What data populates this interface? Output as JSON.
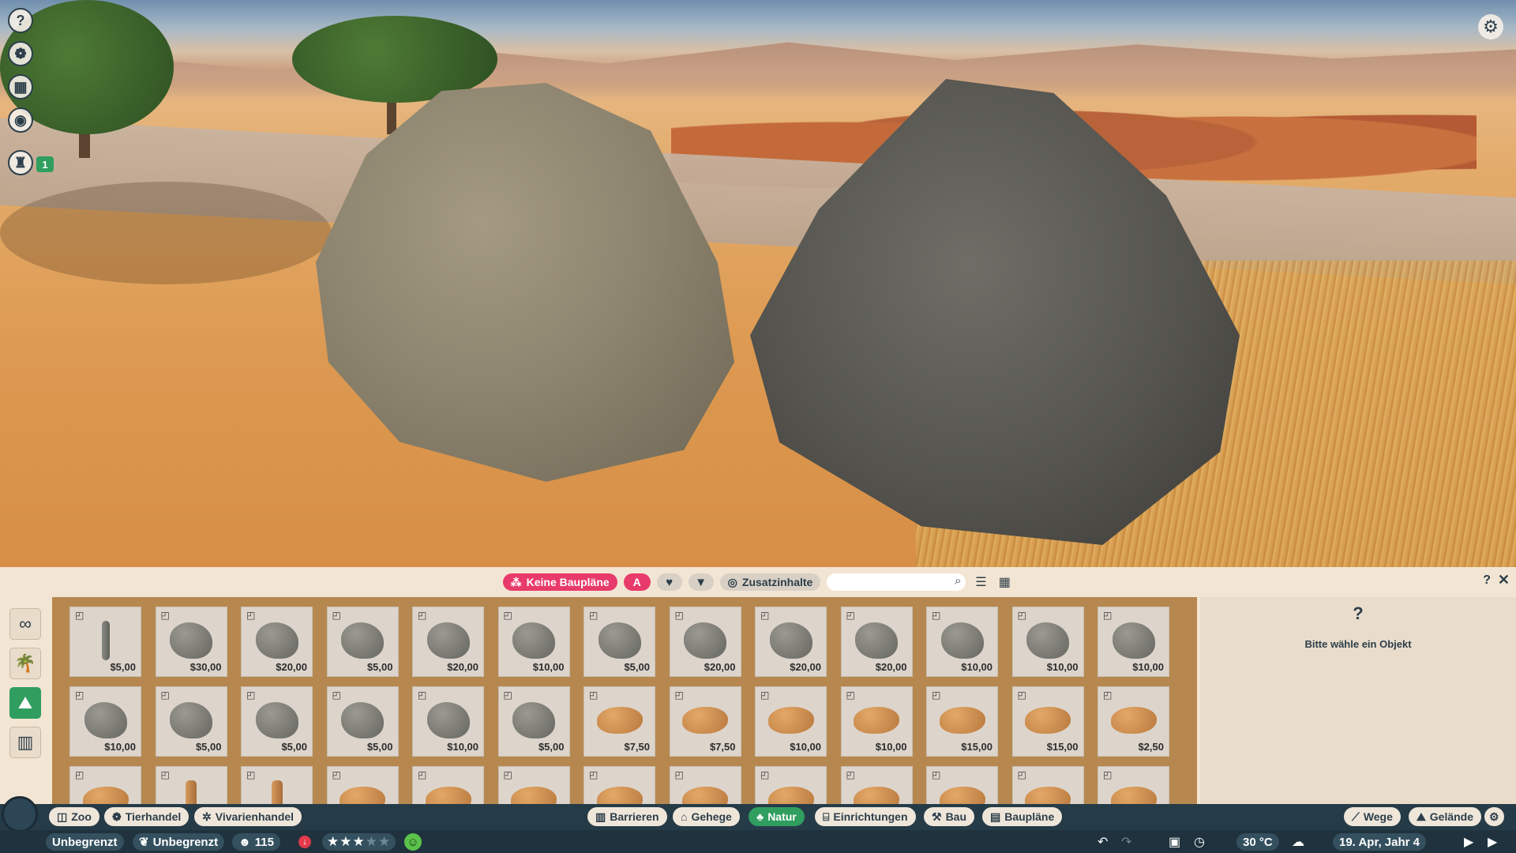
{
  "side_buttons": [
    {
      "name": "help",
      "icon": "question-icon",
      "glyph": "?"
    },
    {
      "name": "animals",
      "icon": "paw-icon",
      "glyph": "❁"
    },
    {
      "name": "schedule",
      "icon": "calendar-icon",
      "glyph": "▦"
    },
    {
      "name": "view",
      "icon": "eye-icon",
      "glyph": "◉"
    },
    {
      "name": "staff",
      "icon": "person-icon",
      "glyph": "♜"
    }
  ],
  "staff_badge": "1",
  "settings_icon": "gear-icon",
  "toolbar": {
    "blueprints_label": "Keine Baupläne",
    "alpha_label": "A",
    "favorite_icon": "heart-icon",
    "filter_icon": "filter-icon",
    "content_label": "Zusatzinhalte",
    "search_placeholder": "",
    "help": "?",
    "close": "✕"
  },
  "categories": [
    {
      "name": "infinity",
      "glyph": "∞",
      "active": false
    },
    {
      "name": "plants",
      "glyph": "🌴",
      "active": false
    },
    {
      "name": "rocks",
      "glyph": "⛰",
      "active": true
    },
    {
      "name": "fences",
      "glyph": "▥",
      "active": false
    }
  ],
  "items": [
    {
      "price": "$5,00",
      "kind": "thin"
    },
    {
      "price": "$30,00",
      "kind": "gray"
    },
    {
      "price": "$20,00",
      "kind": "gray"
    },
    {
      "price": "$5,00",
      "kind": "gray"
    },
    {
      "price": "$20,00",
      "kind": "gray"
    },
    {
      "price": "$10,00",
      "kind": "gray"
    },
    {
      "price": "$5,00",
      "kind": "gray"
    },
    {
      "price": "$20,00",
      "kind": "gray"
    },
    {
      "price": "$20,00",
      "kind": "gray"
    },
    {
      "price": "$20,00",
      "kind": "gray"
    },
    {
      "price": "$10,00",
      "kind": "gray"
    },
    {
      "price": "$10,00",
      "kind": "gray"
    },
    {
      "price": "$10,00",
      "kind": "gray"
    },
    {
      "price": "$10,00",
      "kind": "gray"
    },
    {
      "price": "$5,00",
      "kind": "gray"
    },
    {
      "price": "$5,00",
      "kind": "gray"
    },
    {
      "price": "$5,00",
      "kind": "gray"
    },
    {
      "price": "$10,00",
      "kind": "gray"
    },
    {
      "price": "$5,00",
      "kind": "gray"
    },
    {
      "price": "$7,50",
      "kind": "sand"
    },
    {
      "price": "$7,50",
      "kind": "sand"
    },
    {
      "price": "$10,00",
      "kind": "sand"
    },
    {
      "price": "$10,00",
      "kind": "sand"
    },
    {
      "price": "$15,00",
      "kind": "sand"
    },
    {
      "price": "$15,00",
      "kind": "sand"
    },
    {
      "price": "$2,50",
      "kind": "sand"
    },
    {
      "price": "",
      "kind": "sand"
    },
    {
      "price": "",
      "kind": "thinsand"
    },
    {
      "price": "",
      "kind": "thinsand"
    },
    {
      "price": "",
      "kind": "sand"
    },
    {
      "price": "",
      "kind": "sand"
    },
    {
      "price": "",
      "kind": "sand"
    },
    {
      "price": "",
      "kind": "sand"
    },
    {
      "price": "",
      "kind": "sand"
    },
    {
      "price": "",
      "kind": "sand"
    },
    {
      "price": "",
      "kind": "sand"
    },
    {
      "price": "",
      "kind": "sand"
    },
    {
      "price": "",
      "kind": "sand"
    },
    {
      "price": "",
      "kind": "sand"
    }
  ],
  "info": {
    "icon": "?",
    "text": "Bitte wähle ein Objekt"
  },
  "hud": {
    "left_tabs": [
      "Zoo",
      "Tierhandel",
      "Vivarienhandel"
    ],
    "center_tabs": [
      "Barrieren",
      "Gehege",
      "Natur",
      "Einrichtungen",
      "Bau",
      "Baupläne"
    ],
    "active_tab": "Natur",
    "right_tabs": [
      "Wege",
      "Gelände"
    ],
    "money": "Unbegrenzt",
    "research": "Unbegrenzt",
    "guests": "115",
    "rating": 2.5,
    "rating_max": 5,
    "temperature": "30 °C",
    "date": "19. Apr, Jahr 4"
  }
}
